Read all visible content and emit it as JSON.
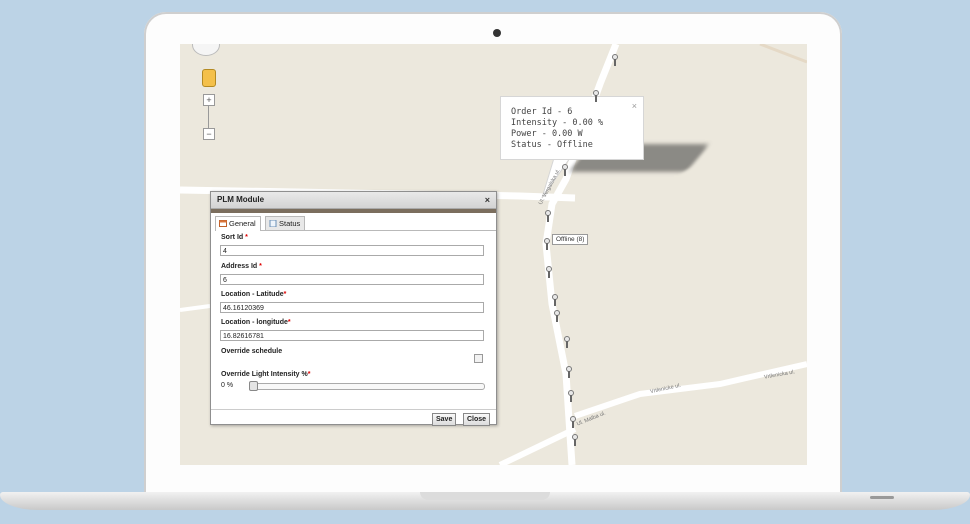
{
  "map": {
    "info_window": {
      "lines": [
        "Order Id - 6",
        "Intensity - 0.00 %",
        "Power - 0.00 W",
        "Status - Offline"
      ],
      "close_symbol": "×"
    },
    "offline_label": "Offline (8)",
    "zoom_in": "+",
    "zoom_out": "−",
    "street_labels": [
      "Ul. Vergalska ul.",
      "Vrtlenicke ul.",
      "Vrtlenicka ul.",
      "Ul. Malba ul."
    ]
  },
  "dialog": {
    "title": "PLM Module",
    "close_symbol": "×",
    "tabs": [
      {
        "label": "General",
        "icon": "calendar-icon",
        "active": true
      },
      {
        "label": "Status",
        "icon": "document-icon",
        "active": false
      }
    ],
    "fields": {
      "sort_id": {
        "label": "Sort Id",
        "value": "4",
        "required": "*"
      },
      "address_id": {
        "label": "Address Id",
        "value": "6",
        "required": "*"
      },
      "latitude": {
        "label": "Location - Latitude",
        "value": "46.16120369",
        "required": "*"
      },
      "longitude": {
        "label": "Location - longitude",
        "value": "16.82616781",
        "required": "*"
      }
    },
    "override_schedule_label": "Override schedule",
    "override_schedule_checked": false,
    "intensity": {
      "label": "Override Light Intensity %",
      "required": "*",
      "value_text": "0  %",
      "value": 0
    },
    "buttons": {
      "save": "Save",
      "close": "Close"
    }
  },
  "colors": {
    "background": "#bcd3e6",
    "map": "#ece8dd",
    "road": "#ffffff",
    "dialog_bar": "#7b6e5e",
    "required": "#dd0000"
  }
}
